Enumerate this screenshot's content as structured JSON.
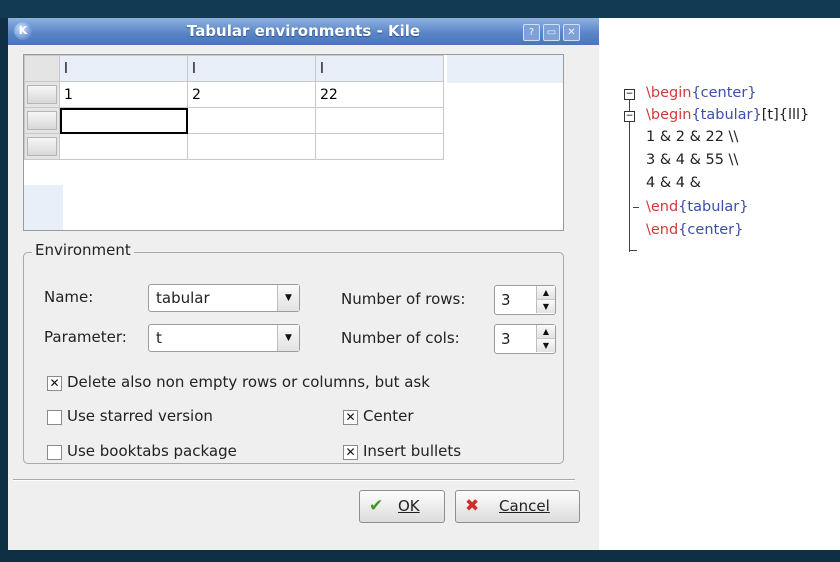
{
  "window": {
    "title": "Tabular environments - Kile",
    "app_icon": "kile-icon"
  },
  "table": {
    "header": [
      "l",
      "l",
      "l"
    ],
    "rows": [
      [
        "1",
        "2",
        "22"
      ],
      [
        "",
        "",
        ""
      ],
      [
        "",
        "",
        ""
      ]
    ]
  },
  "environment": {
    "group_label": "Environment",
    "name_label": "Name:",
    "name_value": "tabular",
    "parameter_label": "Parameter:",
    "parameter_value": "t",
    "rows_label": "Number of rows:",
    "rows_value": "3",
    "cols_label": "Number of cols:",
    "cols_value": "3"
  },
  "options": {
    "delete_label": "Delete also non empty rows or columns, but ask",
    "delete_checked": true,
    "starred_label": "Use starred version",
    "starred_checked": false,
    "booktabs_label": "Use booktabs package",
    "booktabs_checked": false,
    "center_label": "Center",
    "center_checked": true,
    "bullets_label": "Insert bullets",
    "bullets_checked": true
  },
  "buttons": {
    "ok": "OK",
    "cancel": "Cancel"
  },
  "preview": {
    "line1_cmd": "\\begin",
    "line1_arg": "{center}",
    "line2_cmd": "\\begin",
    "line2_arg": "{tabular}",
    "line2_rest": "[t]{lll}",
    "line3": "1 & 2 & 22 \\\\",
    "line4": "3 & 4 & 55 \\\\",
    "line5": "4 & 4 &",
    "line6_cmd": "\\end",
    "line6_arg": "{tabular}",
    "line7_cmd": "\\end",
    "line7_arg": "{center}"
  },
  "colors": {
    "keyword": "#d23a3a",
    "argument": "#3c4fa8",
    "titlebar": "#5a86c8"
  }
}
